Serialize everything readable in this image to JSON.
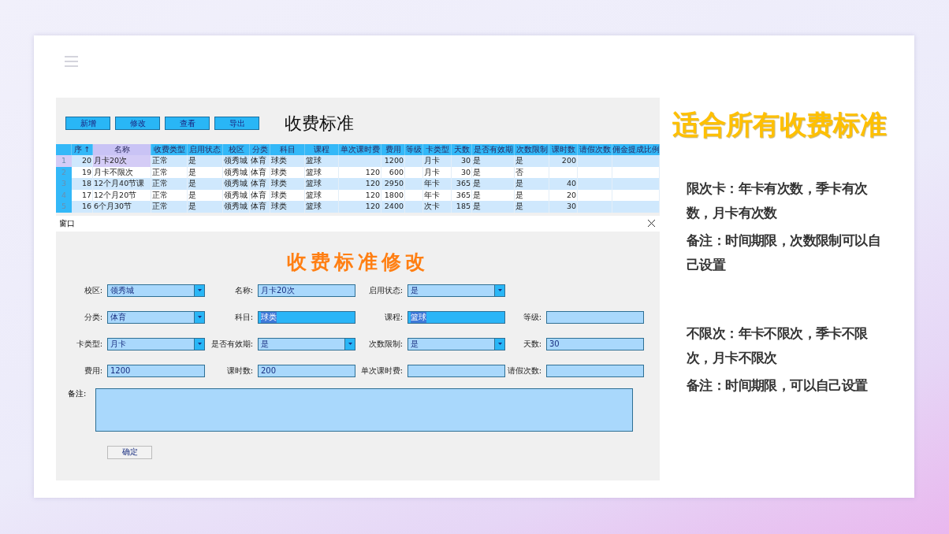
{
  "app": {
    "toolbar": {
      "buttons": [
        "新增",
        "修改",
        "查看",
        "导出"
      ],
      "title": "收费标准"
    },
    "table": {
      "columns": [
        {
          "label": "序",
          "sort": "↑",
          "numeric": true,
          "selected": false
        },
        {
          "label": "名称",
          "numeric": false,
          "selected": true
        },
        {
          "label": "收费类型",
          "numeric": false,
          "selected": false
        },
        {
          "label": "启用状态",
          "numeric": false,
          "selected": false
        },
        {
          "label": "校区",
          "numeric": false,
          "selected": false
        },
        {
          "label": "分类",
          "numeric": false,
          "selected": false
        },
        {
          "label": "科目",
          "numeric": false,
          "selected": false
        },
        {
          "label": "课程",
          "numeric": false,
          "selected": false
        },
        {
          "label": "单次课时费",
          "numeric": true,
          "selected": false
        },
        {
          "label": "费用",
          "numeric": true,
          "selected": false
        },
        {
          "label": "等级",
          "selected": false
        },
        {
          "label": "卡类型",
          "numeric": false,
          "selected": false
        },
        {
          "label": "天数",
          "numeric": true,
          "selected": false
        },
        {
          "label": "是否有效期",
          "numeric": false,
          "selected": false
        },
        {
          "label": "次数限制",
          "numeric": false,
          "selected": false
        },
        {
          "label": "课时数",
          "numeric": true,
          "selected": false
        },
        {
          "label": "请假次数",
          "selected": false
        },
        {
          "label": "佣金提成比例",
          "selected": false
        }
      ],
      "rows": [
        {
          "number": "1",
          "selected": true,
          "cells": [
            "20",
            "月卡20次",
            "正常",
            "是",
            "领秀城",
            "体育",
            "球类",
            "篮球",
            "",
            "1200",
            "",
            "月卡",
            "30",
            "是",
            "是",
            "200",
            "",
            ""
          ]
        },
        {
          "number": "2",
          "selected": false,
          "cells": [
            "19",
            "月卡不限次",
            "正常",
            "是",
            "领秀城",
            "体育",
            "球类",
            "篮球",
            "120",
            "600",
            "",
            "月卡",
            "30",
            "是",
            "否",
            "",
            "",
            ""
          ]
        },
        {
          "number": "3",
          "selected": false,
          "cells": [
            "18",
            "12个月40节课",
            "正常",
            "是",
            "领秀城",
            "体育",
            "球类",
            "篮球",
            "120",
            "2950",
            "",
            "年卡",
            "365",
            "是",
            "是",
            "40",
            "",
            ""
          ]
        },
        {
          "number": "4",
          "selected": false,
          "cells": [
            "17",
            "12个月20节",
            "正常",
            "是",
            "领秀城",
            "体育",
            "球类",
            "篮球",
            "120",
            "1800",
            "",
            "年卡",
            "365",
            "是",
            "是",
            "20",
            "",
            ""
          ]
        },
        {
          "number": "5",
          "selected": false,
          "cells": [
            "16",
            "6个月30节",
            "正常",
            "是",
            "领秀城",
            "体育",
            "球类",
            "篮球",
            "120",
            "2400",
            "",
            "次卡",
            "185",
            "是",
            "是",
            "30",
            "",
            ""
          ]
        }
      ]
    },
    "dialog": {
      "window_title": "窗口",
      "heading": "收费标准修改",
      "fields": [
        {
          "label": "校区:",
          "value": "领秀城",
          "kind": "select",
          "highlighted": false
        },
        {
          "label": "名称:",
          "value": "月卡20次",
          "kind": "text",
          "highlighted": false
        },
        {
          "label": "启用状态:",
          "value": "是",
          "kind": "select",
          "highlighted": false
        },
        {
          "kind": "empty"
        },
        {
          "label": "分类:",
          "value": "体育",
          "kind": "select",
          "highlighted": false
        },
        {
          "label": "科目:",
          "value": "球类",
          "kind": "text",
          "highlighted": true
        },
        {
          "label": "课程:",
          "value": "篮球",
          "kind": "text",
          "highlighted": true
        },
        {
          "label": "等级:",
          "kind": "text",
          "highlighted": false
        },
        {
          "label": "卡类型:",
          "value": "月卡",
          "kind": "select",
          "highlighted": false
        },
        {
          "label": "是否有效期:",
          "value": "是",
          "kind": "select",
          "highlighted": false
        },
        {
          "label": "次数限制:",
          "value": "是",
          "kind": "select",
          "highlighted": false
        },
        {
          "label": "天数:",
          "value": "30",
          "kind": "text",
          "highlighted": false
        },
        {
          "label": "费用:",
          "value": "1200",
          "kind": "text",
          "highlighted": false
        },
        {
          "label": "课时数:",
          "value": "200",
          "kind": "text",
          "highlighted": false
        },
        {
          "label": "单次课时费:",
          "kind": "text",
          "highlighted": false
        },
        {
          "label": "请假次数:",
          "kind": "text",
          "highlighted": false
        }
      ],
      "notes_label": "备注:",
      "confirm_button": "确定"
    }
  },
  "side": {
    "title": "适合所有收费标准",
    "groups": [
      [
        "限次卡：年卡有次数，季卡有次数，月卡有次数",
        "备注：时间期限，次数限制可以自己设置"
      ],
      [
        "不限次：年卡不限次，季卡不限次，月卡不限次",
        "备注：时间期限，可以自己设置"
      ]
    ]
  }
}
